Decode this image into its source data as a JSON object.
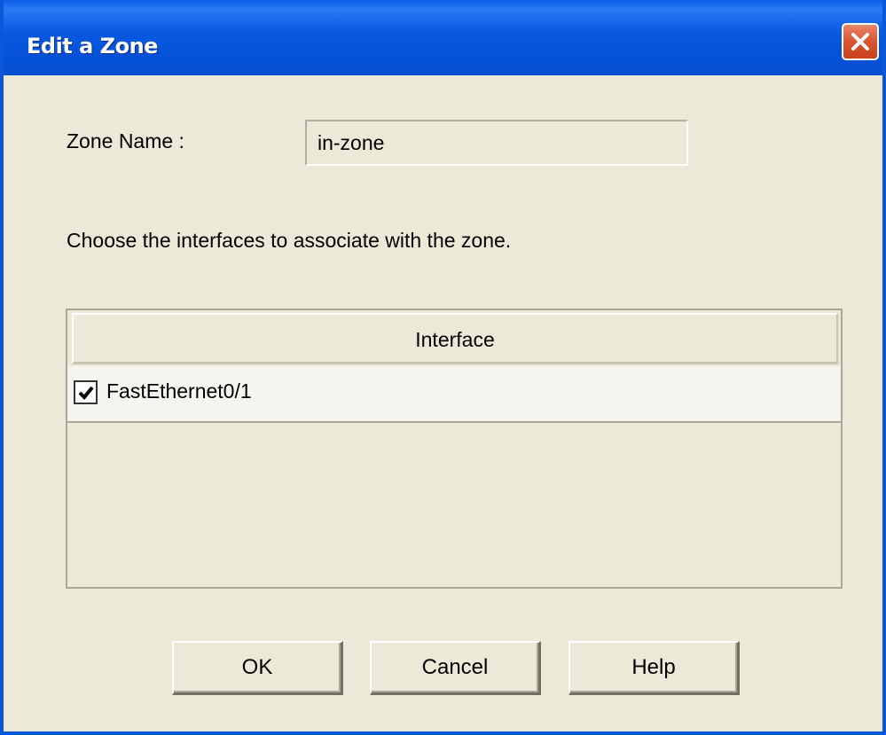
{
  "window": {
    "title": "Edit a Zone"
  },
  "form": {
    "zone_name_label": "Zone Name :",
    "zone_name_value": "in-zone",
    "instructions": "Choose the interfaces to associate with the zone."
  },
  "table": {
    "column_header": "Interface",
    "rows": [
      {
        "label": "FastEthernet0/1",
        "checked": true
      }
    ]
  },
  "buttons": {
    "ok": "OK",
    "cancel": "Cancel",
    "help": "Help"
  },
  "colors": {
    "titlebar": "#0558e0",
    "dialog_background": "#ece9d8",
    "close_button": "#d9542f"
  },
  "icons": {
    "close": "close-icon",
    "check": "checkmark-icon"
  }
}
